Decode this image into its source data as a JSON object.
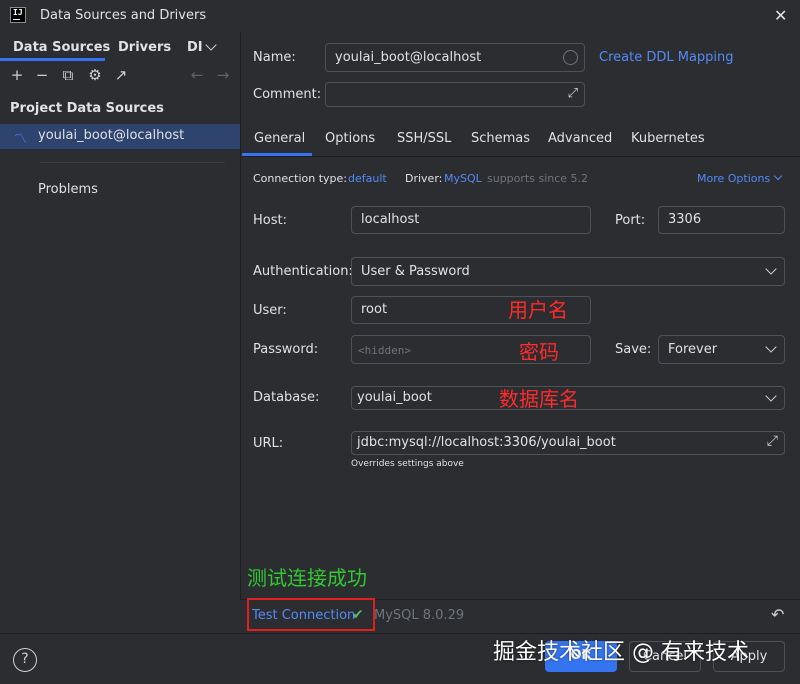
{
  "window": {
    "title": "Data Sources and Drivers",
    "icon_text": "IJ"
  },
  "left": {
    "tabs": [
      "Data Sources",
      "Drivers",
      "DI"
    ],
    "section_title": "Project Data Sources",
    "datasource": "youlai_boot@localhost",
    "problems": "Problems",
    "toolbar_icons": [
      "add-icon",
      "remove-icon",
      "copy-icon",
      "settings-icon",
      "open-icon",
      "back-icon",
      "forward-icon"
    ]
  },
  "header": {
    "name_label": "Name:",
    "name_value": "youlai_boot@localhost",
    "create_ddl": "Create DDL Mapping",
    "comment_label": "Comment:"
  },
  "tabs": [
    "General",
    "Options",
    "SSH/SSL",
    "Schemas",
    "Advanced",
    "Kubernetes"
  ],
  "general": {
    "conn_type_label": "Connection type:",
    "conn_type_value": "default",
    "driver_label": "Driver:",
    "driver_value": "MySQL",
    "driver_note": "supports since 5.2",
    "more_options": "More Options",
    "host_label": "Host:",
    "host_value": "localhost",
    "port_label": "Port:",
    "port_value": "3306",
    "auth_label": "Authentication:",
    "auth_value": "User & Password",
    "user_label": "User:",
    "user_value": "root",
    "password_label": "Password:",
    "password_placeholder": "<hidden>",
    "save_label": "Save:",
    "save_value": "Forever",
    "database_label": "Database:",
    "database_value": "youlai_boot",
    "url_label": "URL:",
    "url_value": "jdbc:mysql://localhost:3306/youlai_boot",
    "url_hint": "Overrides settings above"
  },
  "annotations": {
    "user": "用户名",
    "password": "密码",
    "database": "数据库名",
    "success": "测试连接成功"
  },
  "test": {
    "label": "Test Connection",
    "result": "MySQL 8.0.29"
  },
  "buttons": {
    "ok": "OK",
    "cancel": "Cancel",
    "apply": "Apply",
    "help": "?"
  },
  "watermark": "掘金技术社区 @ 有来技术",
  "colors": {
    "accent": "#3574f0",
    "link": "#548af7",
    "annotation_red": "#ff2a2a",
    "annotation_green": "#32c832",
    "success_check": "#5fb865"
  }
}
